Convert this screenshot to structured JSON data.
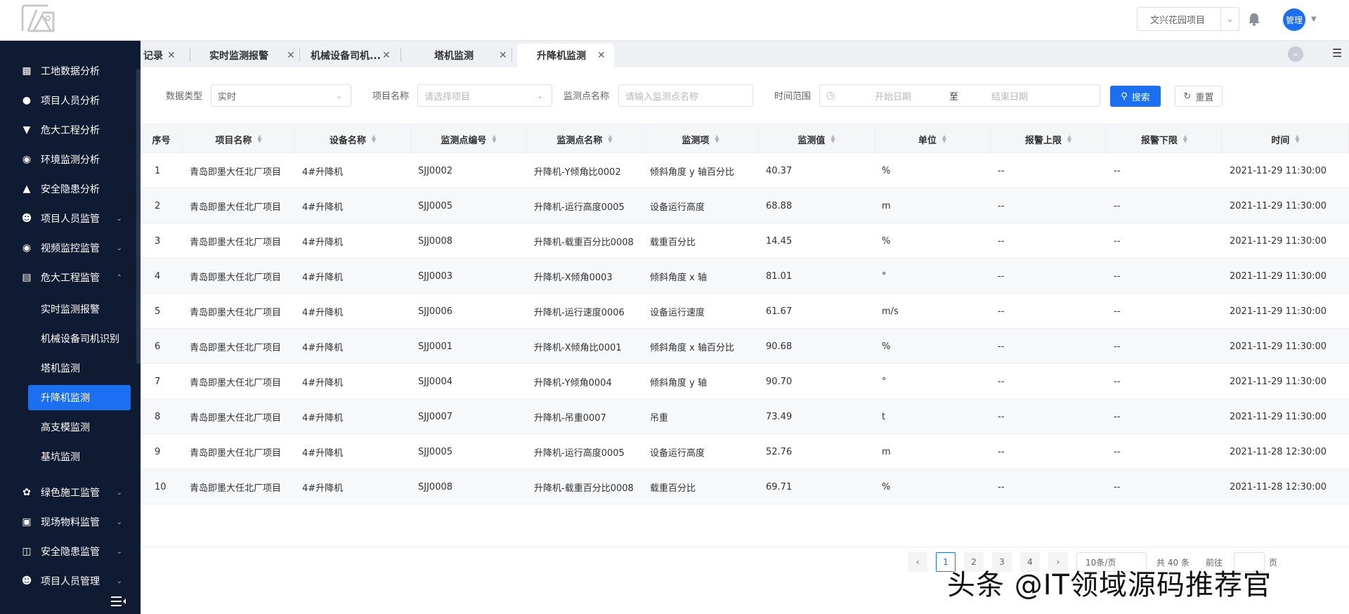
{
  "header": {
    "project": "文兴花园项目",
    "user": "管理"
  },
  "sidebar": {
    "items": [
      {
        "label": "工地数据分析",
        "icon": "chart-icon"
      },
      {
        "label": "项目人员分析",
        "icon": "person-icon"
      },
      {
        "label": "危大工程分析",
        "icon": "filter-icon"
      },
      {
        "label": "环境监测分析",
        "icon": "globe-icon"
      },
      {
        "label": "安全隐患分析",
        "icon": "warning-icon"
      },
      {
        "label": "项目人员监管",
        "icon": "people-icon",
        "expandable": true
      },
      {
        "label": "视频监控监管",
        "icon": "camera-icon",
        "expandable": true
      },
      {
        "label": "危大工程监管",
        "icon": "archive-icon",
        "expandable": true,
        "expanded": true
      }
    ],
    "sub_items": [
      {
        "label": "实时监测报警"
      },
      {
        "label": "机械设备司机识别"
      },
      {
        "label": "塔机监测"
      },
      {
        "label": "升降机监测",
        "active": true
      },
      {
        "label": "高支模监测"
      },
      {
        "label": "基坑监测"
      }
    ],
    "bottom_items": [
      {
        "label": "绿色施工监管",
        "icon": "leaf-icon"
      },
      {
        "label": "现场物料监管",
        "icon": "box-icon"
      },
      {
        "label": "安全隐患监管",
        "icon": "shield-icon"
      },
      {
        "label": "项目人员管理",
        "icon": "people-icon"
      }
    ]
  },
  "tabs": [
    {
      "label": "记录"
    },
    {
      "label": "实时监测报警"
    },
    {
      "label": "机械设备司机..."
    },
    {
      "label": "塔机监测"
    },
    {
      "label": "升降机监测",
      "active": true
    }
  ],
  "filters": {
    "data_type_label": "数据类型",
    "data_type_value": "实时",
    "project_label": "项目名称",
    "project_placeholder": "请选择项目",
    "point_label": "监测点名称",
    "point_placeholder": "请输入监测点名称",
    "time_label": "时间范围",
    "start_placeholder": "开始日期",
    "range_sep": "至",
    "end_placeholder": "结束日期",
    "search_button": "搜索",
    "reset_button": "重置"
  },
  "table": {
    "columns": [
      "序号",
      "项目名称",
      "设备名称",
      "监测点编号",
      "监测点名称",
      "监测项",
      "监测值",
      "单位",
      "报警上限",
      "报警下限",
      "时间"
    ],
    "rows": [
      [
        "1",
        "青岛即墨大任北厂项目",
        "4#升降机",
        "SJJ0002",
        "升降机-Y倾角比0002",
        "倾斜角度 y 轴百分比",
        "40.37",
        "%",
        "--",
        "--",
        "2021-11-29 11:30:00"
      ],
      [
        "2",
        "青岛即墨大任北厂项目",
        "4#升降机",
        "SJJ0005",
        "升降机-运行高度0005",
        "设备运行高度",
        "68.88",
        "m",
        "--",
        "--",
        "2021-11-29 11:30:00"
      ],
      [
        "3",
        "青岛即墨大任北厂项目",
        "4#升降机",
        "SJJ0008",
        "升降机-载重百分比0008",
        "载重百分比",
        "14.45",
        "%",
        "--",
        "--",
        "2021-11-29 11:30:00"
      ],
      [
        "4",
        "青岛即墨大任北厂项目",
        "4#升降机",
        "SJJ0003",
        "升降机-X倾角0003",
        "倾斜角度 x 轴",
        "81.01",
        "°",
        "--",
        "--",
        "2021-11-29 11:30:00"
      ],
      [
        "5",
        "青岛即墨大任北厂项目",
        "4#升降机",
        "SJJ0006",
        "升降机-运行速度0006",
        "设备运行速度",
        "61.67",
        "m/s",
        "--",
        "--",
        "2021-11-29 11:30:00"
      ],
      [
        "6",
        "青岛即墨大任北厂项目",
        "4#升降机",
        "SJJ0001",
        "升降机-X倾角比0001",
        "倾斜角度 x 轴百分比",
        "90.68",
        "%",
        "--",
        "--",
        "2021-11-29 11:30:00"
      ],
      [
        "7",
        "青岛即墨大任北厂项目",
        "4#升降机",
        "SJJ0004",
        "升降机-Y倾角0004",
        "倾斜角度 y 轴",
        "90.70",
        "°",
        "--",
        "--",
        "2021-11-29 11:30:00"
      ],
      [
        "8",
        "青岛即墨大任北厂项目",
        "4#升降机",
        "SJJ0007",
        "升降机-吊重0007",
        "吊重",
        "73.49",
        "t",
        "--",
        "--",
        "2021-11-29 11:30:00"
      ],
      [
        "9",
        "青岛即墨大任北厂项目",
        "4#升降机",
        "SJJ0005",
        "升降机-运行高度0005",
        "设备运行高度",
        "52.76",
        "m",
        "--",
        "--",
        "2021-11-28 12:30:00"
      ],
      [
        "10",
        "青岛即墨大任北厂项目",
        "4#升降机",
        "SJJ0008",
        "升降机-载重百分比0008",
        "载重百分比",
        "69.71",
        "%",
        "--",
        "--",
        "2021-11-28 12:30:00"
      ]
    ]
  },
  "pagination": {
    "pages": [
      "1",
      "2",
      "3",
      "4"
    ],
    "current": "1",
    "page_size": "10条/页",
    "total": "共 40 条",
    "goto_label": "前往",
    "goto_suffix": "页"
  },
  "watermark": "头条 @IT领域源码推荐官",
  "colors": {
    "sidebar_bg": "#0f1b33",
    "accent": "#1d6ff2"
  }
}
